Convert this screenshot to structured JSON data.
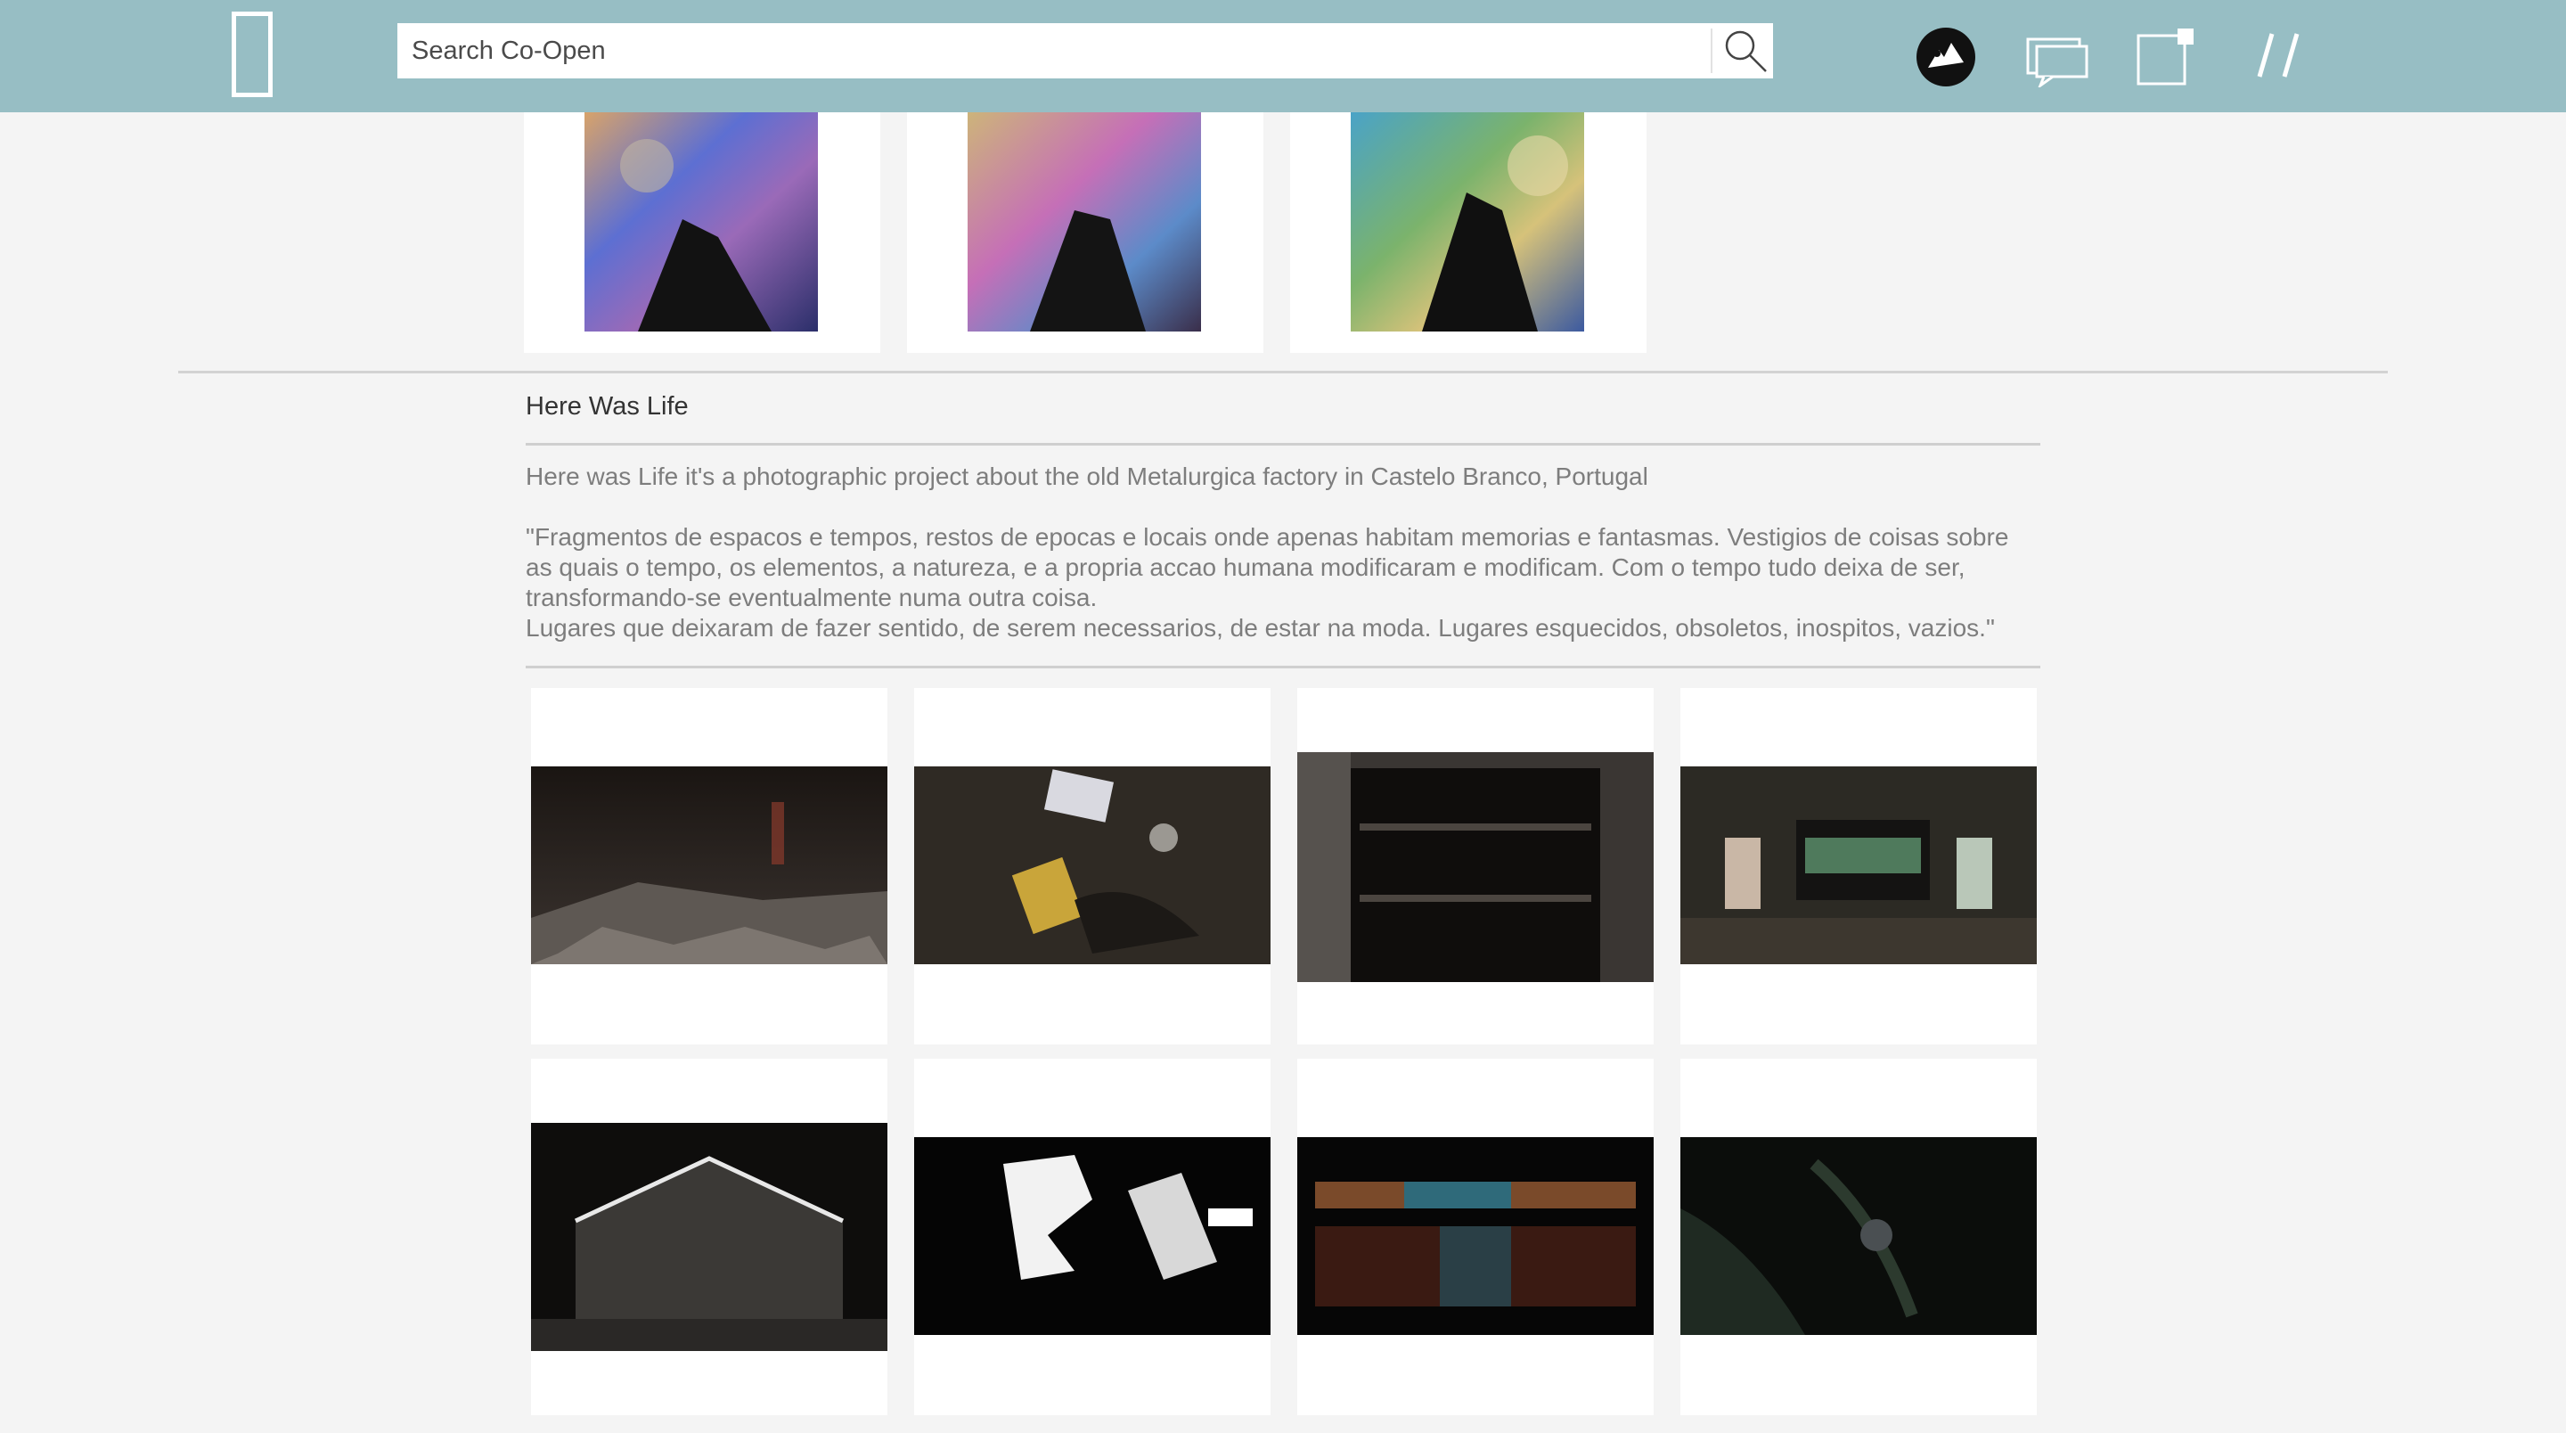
{
  "header": {
    "search_placeholder": "Search Co-Open",
    "icons": [
      "logo-icon",
      "search-icon",
      "avatar-icon",
      "chat-icon",
      "new-post-icon",
      "menu-icon"
    ]
  },
  "top_thumbnails": [
    {
      "alt": "iridescent oil slick photograph 1"
    },
    {
      "alt": "iridescent oil slick photograph 2"
    },
    {
      "alt": "iridescent oil slick photograph 3"
    }
  ],
  "project": {
    "title": "Here Was Life",
    "description": "Here was Life it's a photographic project about the old Metalurgica factory in Castelo Branco, Portugal",
    "quote_p1": "\"Fragmentos de espacos e tempos, restos de epocas e locais onde apenas habitam memorias e fantasmas. Vestigios de coisas sobre as quais o tempo, os elementos, a natureza, e a propria accao humana modificaram e modificam. Com o tempo tudo deixa de ser, transformando-se eventualmente numa outra coisa.",
    "quote_p2": "Lugares que deixaram de fazer sentido, de serem necessarios, de estar na moda. Lugares esquecidos, obsoletos, inospitos, vazios.\""
  },
  "gallery": [
    {
      "alt": "dark factory interior with rubble"
    },
    {
      "alt": "debris with yellow canister on floor"
    },
    {
      "alt": "abandoned shelving in ruined room"
    },
    {
      "alt": "derelict room with windows"
    },
    {
      "alt": "dark hall with gabled roof"
    },
    {
      "alt": "broken skylight silhouette"
    },
    {
      "alt": "shelf of colorful old books"
    },
    {
      "alt": "overgrown palm leaves in dark"
    }
  ],
  "colors": {
    "topbar": "#97bec4",
    "page_bg": "#f4f4f4",
    "card_bg": "#ffffff",
    "title_text": "#333333",
    "body_text": "#7d7d7d"
  }
}
